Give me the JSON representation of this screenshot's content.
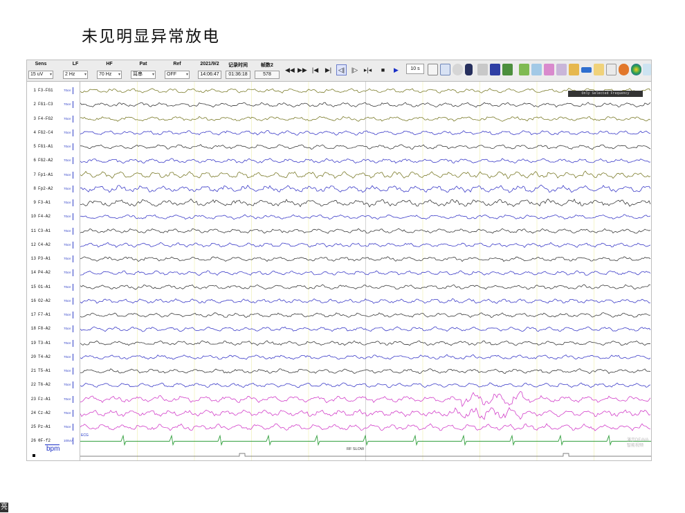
{
  "slide": {
    "title": "未见明显异常放电",
    "corner_mark": "亮"
  },
  "toolbar": {
    "sens_label": "Sens",
    "sens_value": "15 uV",
    "lf_label": "LF",
    "lf_value": "2 Hz",
    "hf_label": "HF",
    "hf_value": "70 Hz",
    "pat_label": "Pat",
    "pat_value": "耳串",
    "ref_label": "Ref",
    "ref_value": "OFF",
    "date_label": "2021/9/2",
    "time_value": "14:06:47",
    "record_label": "记录时间",
    "record_value": "01:36:18",
    "frames_label": "帧数2",
    "frames_value": "578",
    "period_value": "10 s"
  },
  "channels": [
    {
      "num": "1",
      "name": "F3-FG1",
      "scale": "70uV"
    },
    {
      "num": "2",
      "name": "FG1-C3",
      "scale": "70uV"
    },
    {
      "num": "3",
      "name": "F4-FG2",
      "scale": "70uV"
    },
    {
      "num": "4",
      "name": "FG2-C4",
      "scale": "70uV"
    },
    {
      "num": "5",
      "name": "FG1-A1",
      "scale": "70uV"
    },
    {
      "num": "6",
      "name": "FG2-A2",
      "scale": "70uV"
    },
    {
      "num": "7",
      "name": "Fp1-A1",
      "scale": "70uV"
    },
    {
      "num": "8",
      "name": "Fp2-A2",
      "scale": "70uV"
    },
    {
      "num": "9",
      "name": "F3-A1",
      "scale": "70uV"
    },
    {
      "num": "10",
      "name": "F4-A2",
      "scale": "70uV"
    },
    {
      "num": "11",
      "name": "C3-A1",
      "scale": "70uV"
    },
    {
      "num": "12",
      "name": "C4-A2",
      "scale": "70uV"
    },
    {
      "num": "13",
      "name": "P3-A1",
      "scale": "70uV"
    },
    {
      "num": "14",
      "name": "P4-A2",
      "scale": "70uV"
    },
    {
      "num": "15",
      "name": "O1-A1",
      "scale": "70uV"
    },
    {
      "num": "16",
      "name": "O2-A2",
      "scale": "70uV"
    },
    {
      "num": "17",
      "name": "F7-A1",
      "scale": "70uV"
    },
    {
      "num": "18",
      "name": "F8-A2",
      "scale": "70uV"
    },
    {
      "num": "19",
      "name": "T3-A1",
      "scale": "70uV"
    },
    {
      "num": "20",
      "name": "T4-A2",
      "scale": "70uV"
    },
    {
      "num": "21",
      "name": "T5-A1",
      "scale": "70uV"
    },
    {
      "num": "22",
      "name": "T6-A2",
      "scale": "70uV"
    },
    {
      "num": "23",
      "name": "Fz-A1",
      "scale": "70uV"
    },
    {
      "num": "24",
      "name": "Cz-A2",
      "scale": "70uV"
    },
    {
      "num": "25",
      "name": "Pz-A1",
      "scale": "70uV"
    },
    {
      "num": "26",
      "name": "θF-f2",
      "scale": "100uV"
    }
  ],
  "trace_colors": [
    "#7b7b2a",
    "#3a3a3a",
    "#7b7b2a",
    "#3c3cc8",
    "#3a3a3a",
    "#3c3cc8",
    "#7b7b2a",
    "#3c3cc8",
    "#3a3a3a",
    "#3c3cc8",
    "#3a3a3a",
    "#3c3cc8",
    "#3a3a3a",
    "#3c3cc8",
    "#3a3a3a",
    "#3c3cc8",
    "#3a3a3a",
    "#3c3cc8",
    "#3a3a3a",
    "#3c3cc8",
    "#3a3a3a",
    "#3c3cc8",
    "#d23fc9",
    "#d23fc9",
    "#d23fc9"
  ],
  "ecg_color": "#2e9e3a",
  "bpm_label": "bpm",
  "overlay_tag": "Only Selected Frequency",
  "ecg_tag": "ECG",
  "rf_slow": "RF SLOW",
  "watermark_line1": "演示DEAVA",
  "watermark_line2": "智能视频"
}
